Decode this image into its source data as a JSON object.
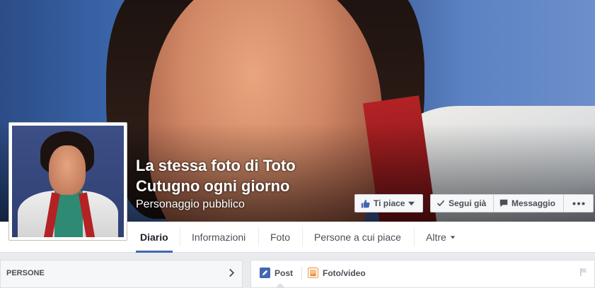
{
  "page": {
    "title": "La stessa foto di Toto Cutugno ogni giorno",
    "category": "Personaggio pubblico"
  },
  "actions": {
    "like": "Ti piace",
    "follow": "Segui già",
    "message": "Messaggio"
  },
  "nav": {
    "tabs": [
      "Diario",
      "Informazioni",
      "Foto",
      "Persone a cui piace",
      "Altre"
    ],
    "active": "Diario"
  },
  "sidebar": {
    "section_label": "PERSONE"
  },
  "composer": {
    "post_label": "Post",
    "photo_label": "Foto/video"
  },
  "colors": {
    "accent": "#4267b2",
    "background": "#e9ebee"
  }
}
